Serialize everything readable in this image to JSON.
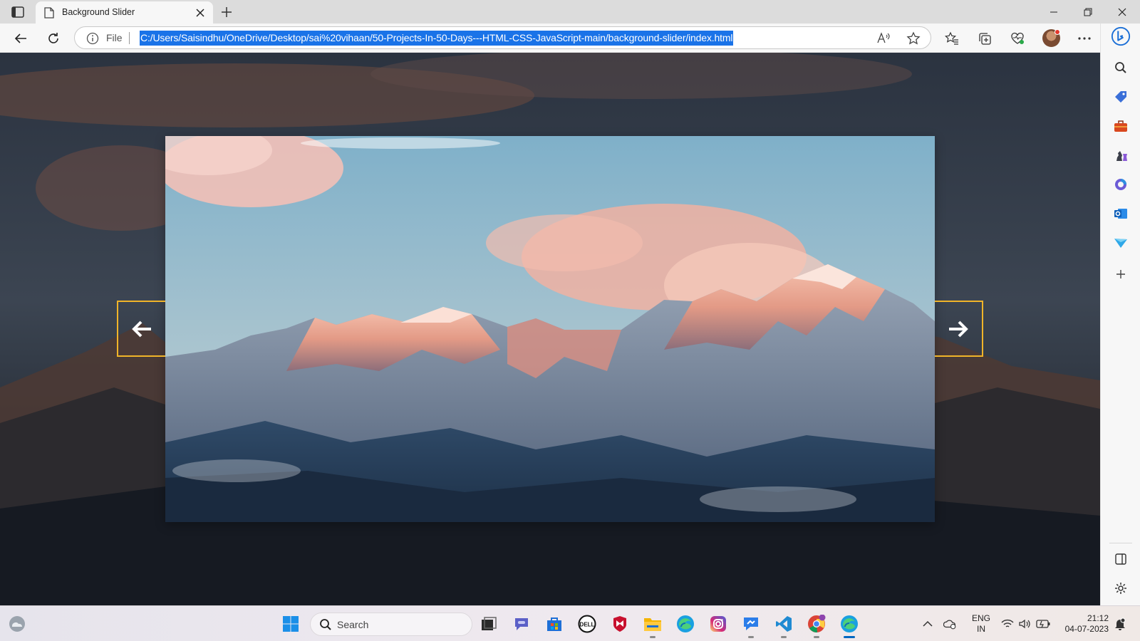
{
  "browser": {
    "tab": {
      "title": "Background Slider"
    },
    "address": {
      "scheme_label": "File",
      "url": "C:/Users/Saisindhu/OneDrive/Desktop/sai%20vihaan/50-Projects-In-50-Days---HTML-CSS-JavaScript-main/background-slider/index.html"
    }
  },
  "slider": {
    "prev_icon": "arrow-left-icon",
    "next_icon": "arrow-right-icon",
    "button_border_color": "#f0b429"
  },
  "sidebar_icons": [
    "search-icon",
    "tag-icon",
    "toolbox-icon",
    "chess-icon",
    "office-icon",
    "outlook-icon",
    "send-icon",
    "add-icon",
    "split-view-icon",
    "settings-icon"
  ],
  "taskbar": {
    "search_placeholder": "Search",
    "apps": [
      "windows-start-icon",
      "task-view-icon",
      "teams-chat-icon",
      "microsoft-store-icon",
      "dell-icon",
      "mcafee-icon",
      "file-explorer-icon",
      "edge-icon",
      "instagram-icon",
      "messenger-icon",
      "vscode-icon",
      "chrome-icon",
      "edge-active-icon"
    ],
    "tray": {
      "language_line1": "ENG",
      "language_line2": "IN",
      "time": "21:12",
      "date": "04-07-2023"
    }
  }
}
